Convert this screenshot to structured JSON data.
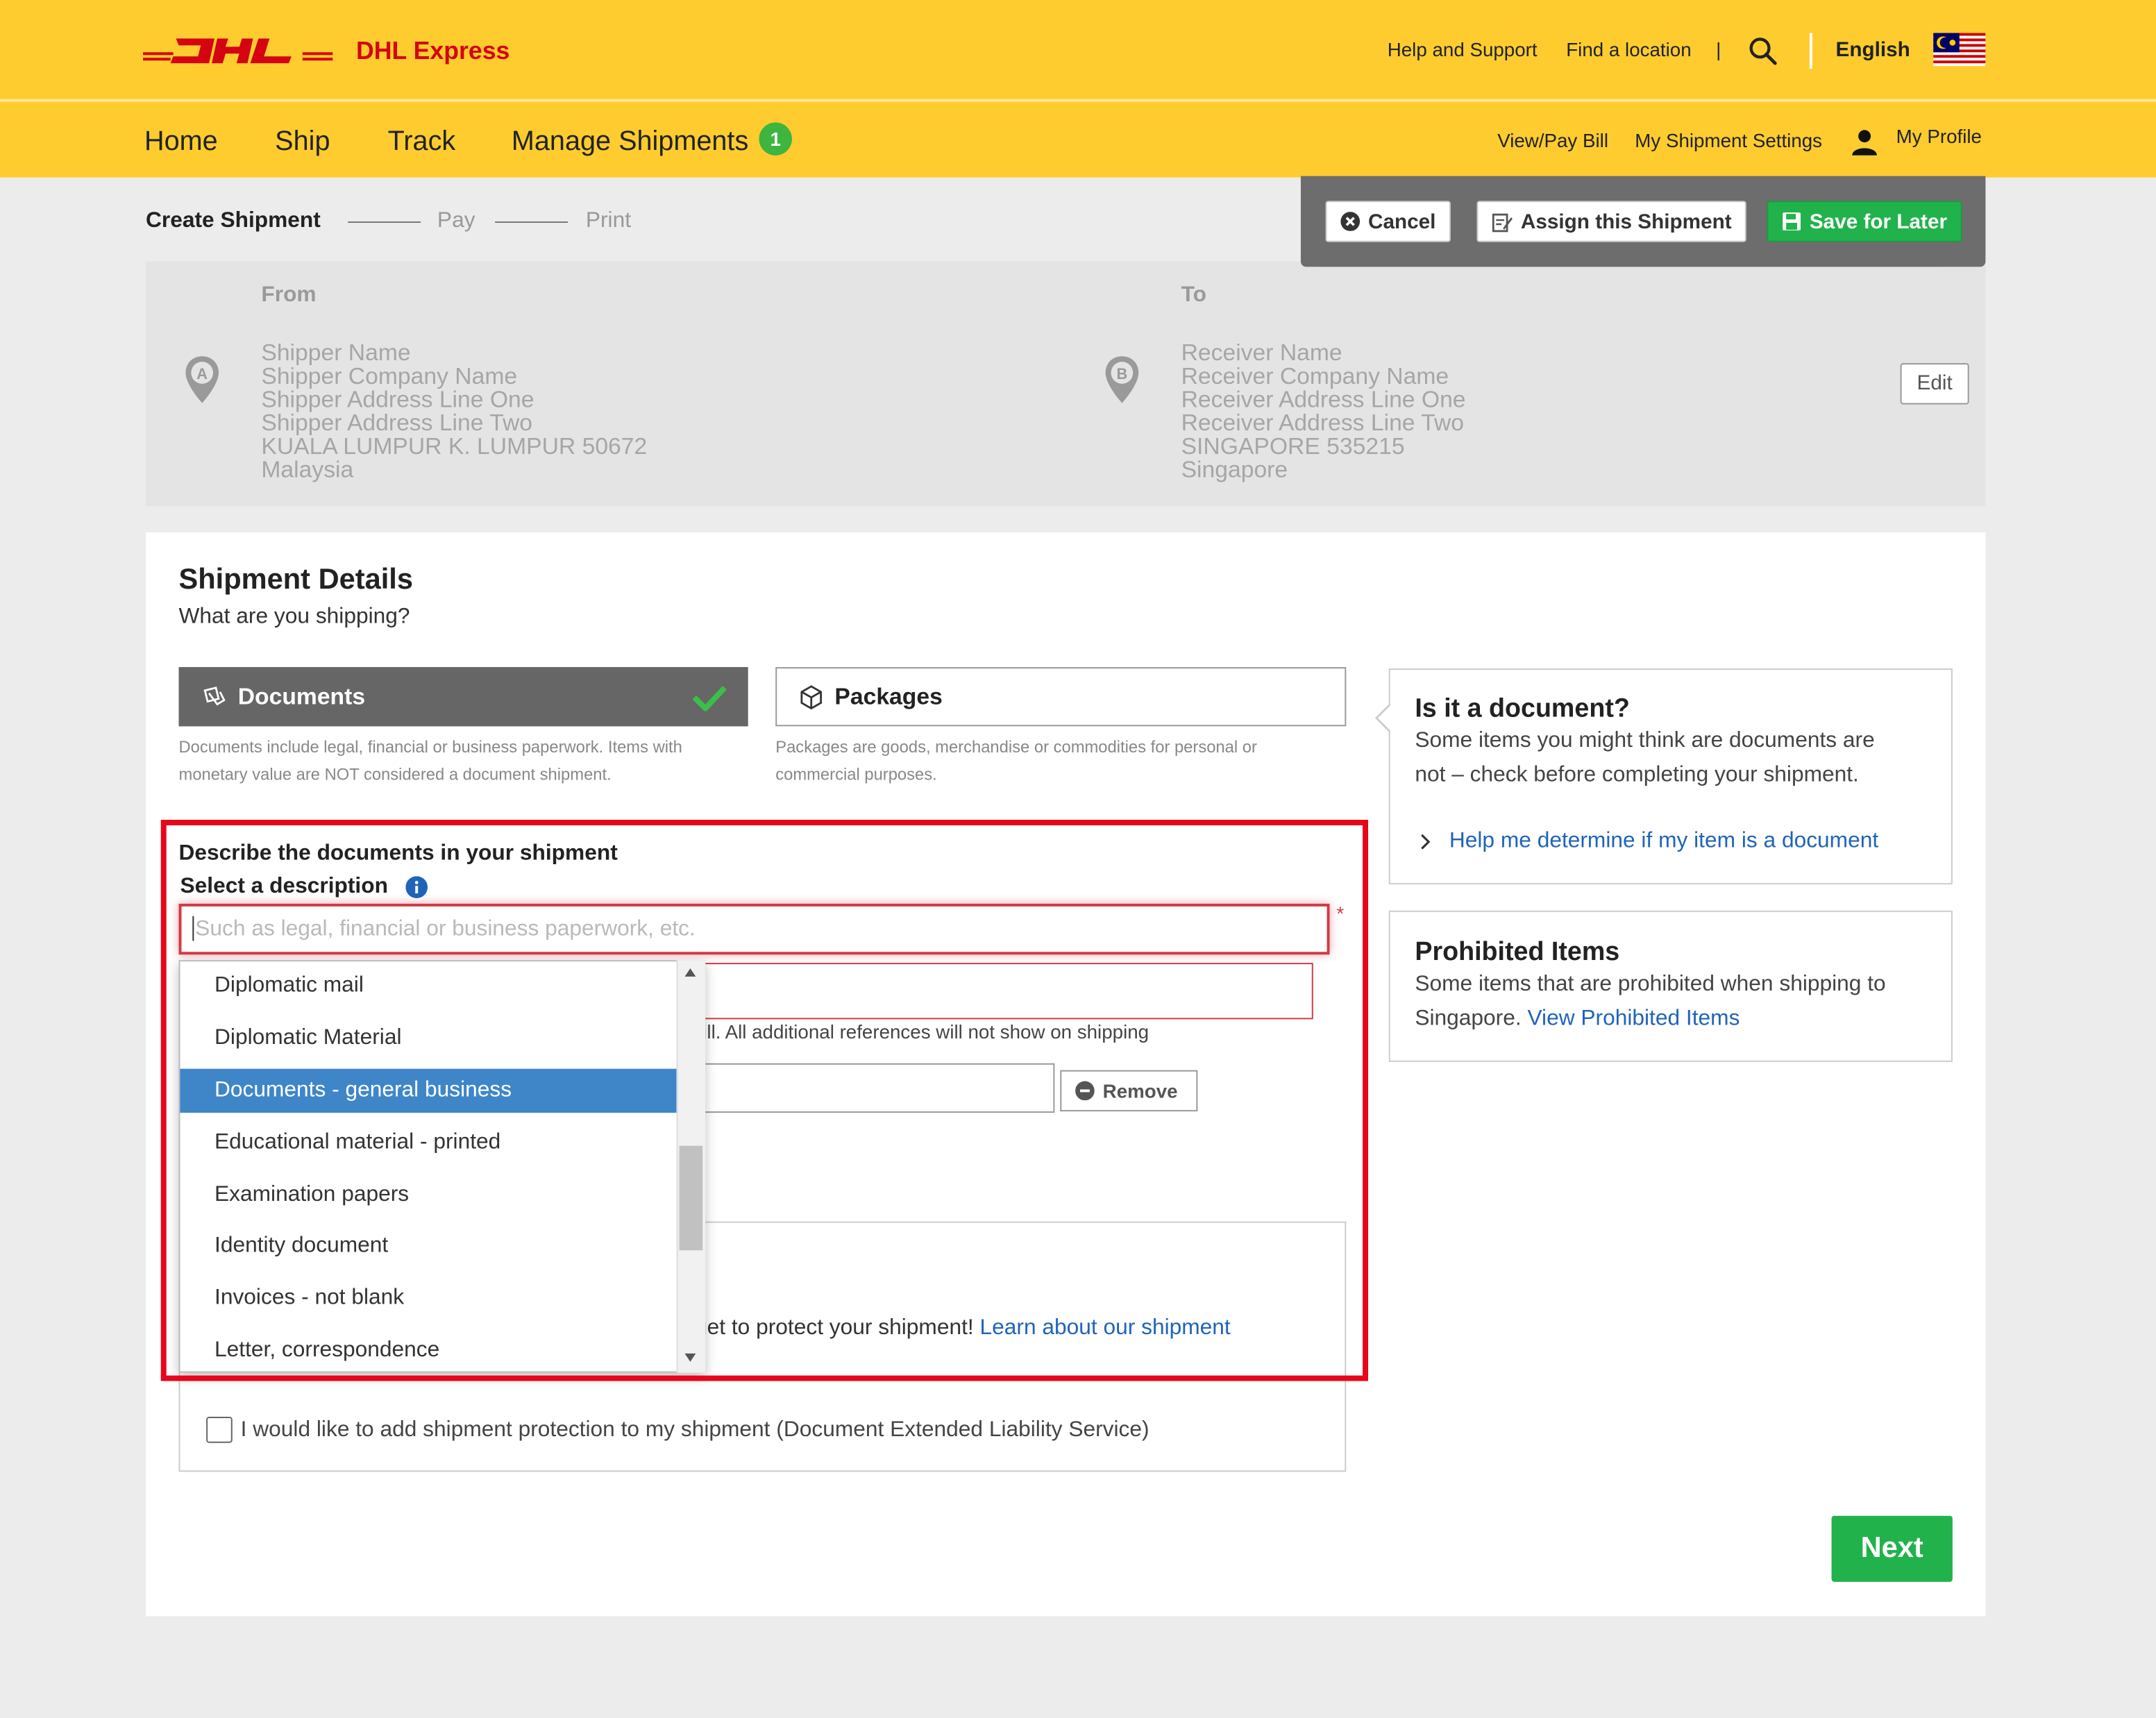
{
  "header": {
    "brand": "DHL Express",
    "help": "Help and Support",
    "find": "Find a location",
    "divider": "|",
    "language": "English"
  },
  "nav": {
    "home": "Home",
    "ship": "Ship",
    "track": "Track",
    "manage": "Manage Shipments",
    "manage_badge": "1",
    "view_pay": "View/Pay Bill",
    "settings": "My Shipment Settings",
    "profile": "My Profile"
  },
  "stepper": {
    "create": "Create Shipment",
    "pay": "Pay",
    "print": "Print"
  },
  "actions": {
    "cancel": "Cancel",
    "assign": "Assign this Shipment",
    "save": "Save for Later"
  },
  "from": {
    "label": "From",
    "marker": "A",
    "lines": [
      "Shipper Name",
      "Shipper Company Name",
      "Shipper Address Line One",
      "Shipper Address Line Two",
      "KUALA LUMPUR K. LUMPUR 50672",
      "Malaysia"
    ]
  },
  "to": {
    "label": "To",
    "marker": "B",
    "lines": [
      "Receiver Name",
      "Receiver Company Name",
      "Receiver Address Line One",
      "Receiver Address Line Two",
      "SINGAPORE 535215",
      "Singapore"
    ]
  },
  "edit": "Edit",
  "details": {
    "title": "Shipment Details",
    "subtitle": "What are you shipping?",
    "documents_label": "Documents",
    "documents_desc_1": "Documents include legal, financial or business paperwork. Items with",
    "documents_desc_2": "monetary value are NOT considered a document shipment.",
    "packages_label": "Packages",
    "packages_desc_1": "Packages are goods, merchandise or commodities for personal or",
    "packages_desc_2": "commercial purposes."
  },
  "describe": {
    "title": "Describe the documents in your shipment",
    "select_label": "Select a description",
    "placeholder": "Such as legal, financial or business paperwork, etc.",
    "required": "*",
    "options": [
      "Diplomatic mail",
      "Diplomatic Material",
      "Documents - general business",
      "Educational material - printed",
      "Examination papers",
      "Identity document",
      "Invoices - not blank",
      "Letter, correspondence"
    ],
    "selected": "Documents - general business",
    "ref_note": "ill. All additional references will not show on shipping",
    "remove": "Remove",
    "protect_text": "rget to protect your shipment!",
    "protect_link": "Learn about our shipment"
  },
  "protection": {
    "checkbox_label": "I would like to add shipment protection to my shipment (Document Extended Liability Service)"
  },
  "sidebar": {
    "doc_title": "Is it a document?",
    "doc_text_1": "Some items you might think are documents are",
    "doc_text_2": "not – check before completing your shipment.",
    "doc_link": "Help me determine if my item is a document",
    "prohib_title": "Prohibited Items",
    "prohib_text_1": "Some items that are prohibited when shipping to",
    "prohib_text_2": "Singapore.",
    "prohib_link": "View Prohibited Items"
  },
  "next": "Next",
  "colors": {
    "dhl_yellow": "#fecc2f",
    "dhl_red": "#d40511",
    "green": "#22b24c",
    "link_blue": "#1f64b8",
    "highlight_red": "#e8061a",
    "selected_blue": "#3f86c9"
  },
  "icons": [
    "dhl-logo",
    "search-icon",
    "malaysia-flag-icon",
    "user-icon",
    "cancel-icon",
    "assign-icon",
    "save-icon",
    "map-pin-icon",
    "documents-icon",
    "packages-icon",
    "checkmark-icon",
    "info-icon",
    "chevron-right-icon",
    "remove-icon",
    "scroll-up-icon",
    "scroll-down-icon"
  ]
}
